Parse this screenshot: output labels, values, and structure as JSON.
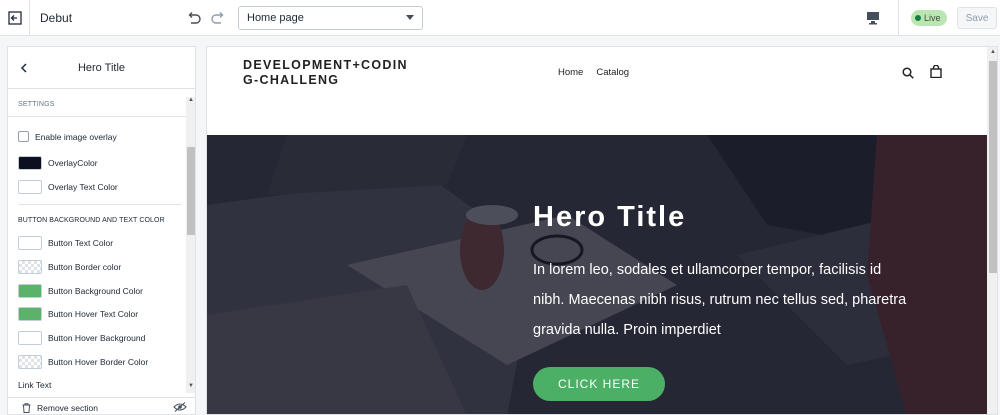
{
  "topbar": {
    "theme_name": "Debut",
    "page_select": "Home page",
    "live_label": "Live",
    "save_label": "Save"
  },
  "panel": {
    "title": "Hero Title",
    "settings_label": "SETTINGS",
    "rows": [
      {
        "label": "Enable image overlay",
        "type": "checkbox"
      },
      {
        "label": "OverlayColor",
        "type": "color",
        "color": "#0c0f1f"
      },
      {
        "label": "Overlay Text Color",
        "type": "color",
        "color": "#ffffff"
      }
    ],
    "group_label": "BUTTON BACKGROUND AND TEXT COLOR",
    "button_rows": [
      {
        "label": "Button Text Color",
        "color": "#ffffff"
      },
      {
        "label": "Button Border color",
        "color": "transparent"
      },
      {
        "label": "Button Background Color",
        "color": "#5bb26b"
      },
      {
        "label": "Button Hover Text Color",
        "color": "#5bb26b"
      },
      {
        "label": "Button Hover Background",
        "color": "#ffffff"
      },
      {
        "label": "Button Hover Border Color",
        "color": "transparent"
      }
    ],
    "link_text_label": "Link Text",
    "remove_label": "Remove section"
  },
  "preview": {
    "logo": "DEVELOPMENT+CODIN G-CHALLENG",
    "nav": [
      "Home",
      "Catalog"
    ],
    "hero": {
      "title": "Hero Title",
      "text": "In lorem leo, sodales et ullamcorper tempor, facilisis id nibh. Maecenas nibh risus, rutrum nec tellus sed, pharetra gravida nulla. Proin imperdiet",
      "button": "CLICK HERE"
    }
  },
  "colors": {
    "accent_green": "#4caf66",
    "overlay": "#0c0f1f",
    "live_badge": "#bbe5b3"
  }
}
